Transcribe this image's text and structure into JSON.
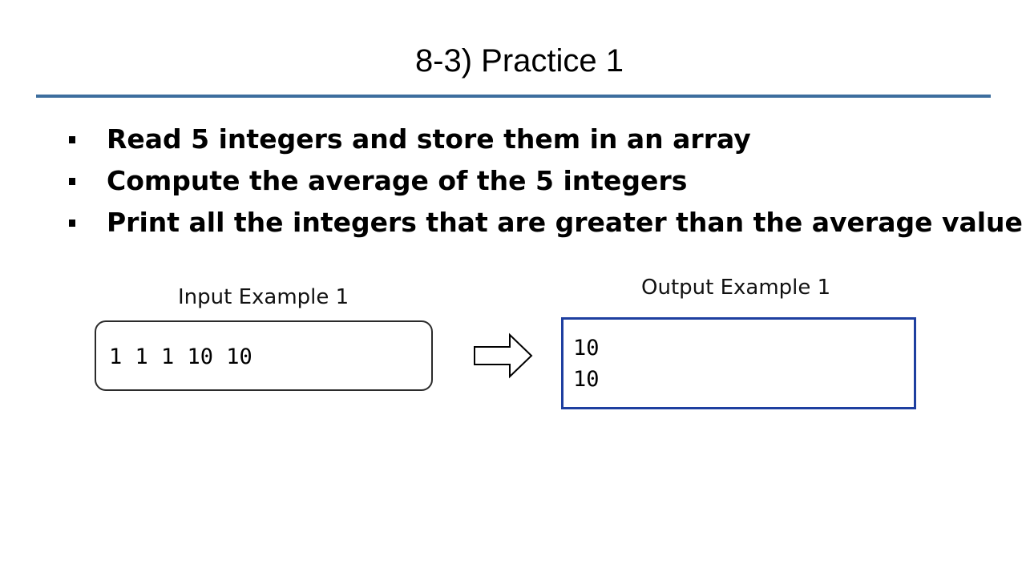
{
  "slide": {
    "title": "8-3) Practice 1",
    "bullets": [
      "Read 5 integers and store them in an array",
      "Compute the average of the 5 integers",
      "Print all the integers that are greater than the average value"
    ],
    "input_example": {
      "label": "Input Example 1",
      "value": "1 1 1 10 10"
    },
    "output_example": {
      "label": "Output Example 1",
      "lines": [
        "10",
        "10"
      ]
    }
  },
  "colors": {
    "rule": "#3d6e9e",
    "output_border": "#1e3fa0",
    "input_border": "#2b2b2b"
  },
  "icons": {
    "transition": "right-arrow-icon"
  }
}
